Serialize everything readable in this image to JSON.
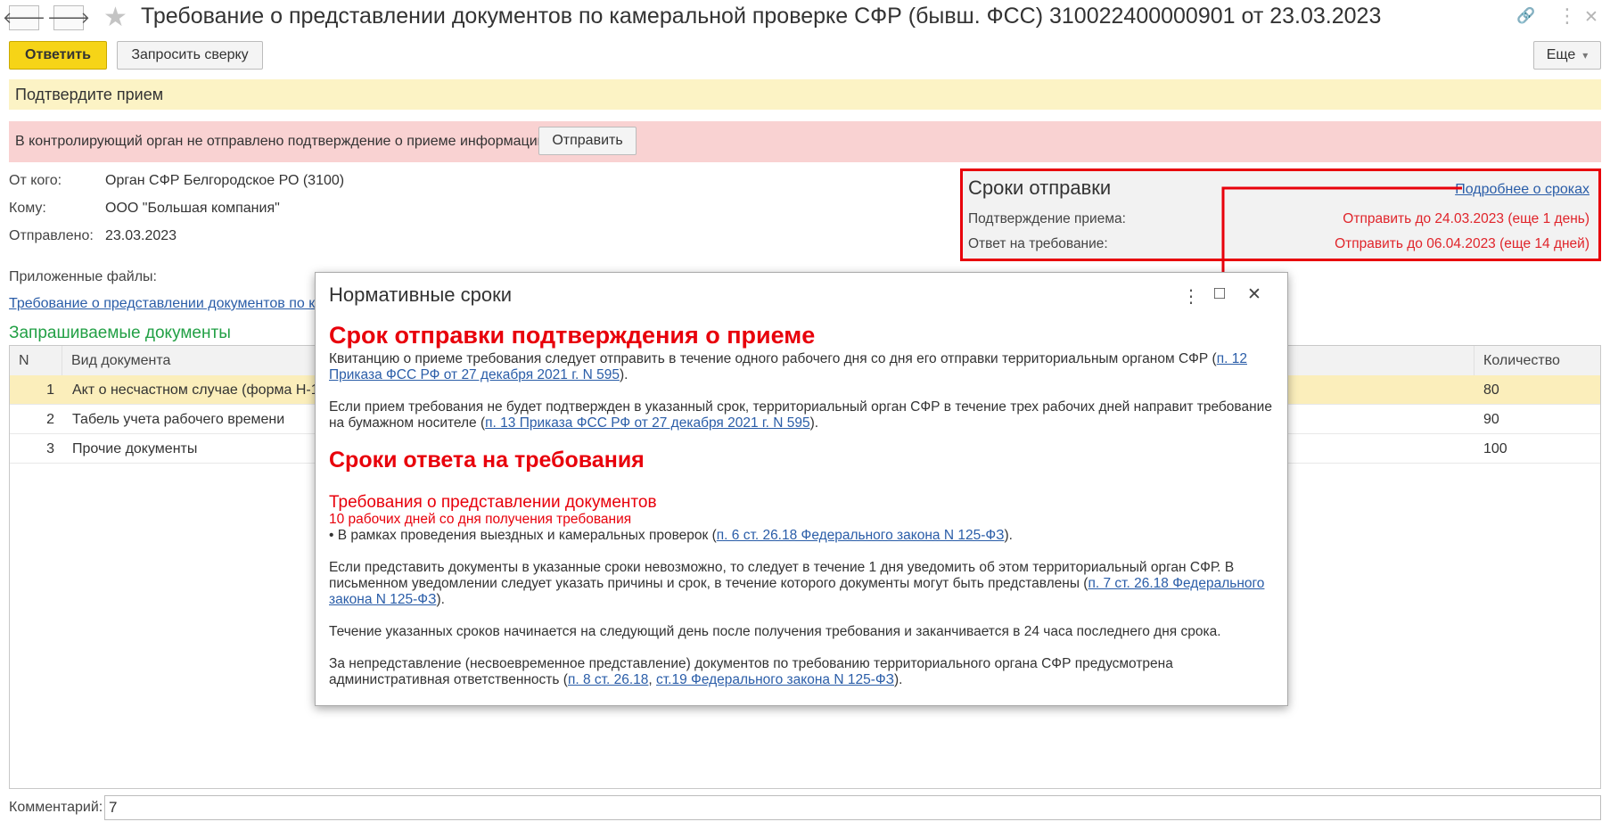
{
  "window": {
    "title": "Требование о представлении документов по камеральной проверке СФР (бывш. ФСС) 310022400000901 от 23.03.2023",
    "back_glyph": "🡐",
    "forward_glyph": "🡒",
    "favorite_glyph": "★",
    "link_glyph": "🔗",
    "menu_glyph": "⋮",
    "close_glyph": "✕"
  },
  "toolbar": {
    "reply_label": "Ответить",
    "reconcile_label": "Запросить сверку",
    "more_label": "Еще",
    "more_glyph": "▾"
  },
  "confirm_bar": {
    "text": "Подтвердите прием"
  },
  "warning_bar": {
    "text": "В контролирующий орган не отправлено подтверждение о приеме информации",
    "send_label": "Отправить"
  },
  "details": {
    "from_label": "От кого:",
    "from_value": "Орган СФР Белгородское РО (3100)",
    "to_label": "Кому:",
    "to_value": "ООО \"Большая компания\"",
    "sent_label": "Отправлено:",
    "sent_value": "23.03.2023",
    "files_label": "Приложенные файлы:",
    "file_link": "Требование о представлении документов по ка"
  },
  "deadlines": {
    "title": "Сроки отправки",
    "details_link": "Подробнее о сроках",
    "rows": [
      {
        "label": "Подтверждение приема:",
        "value": "Отправить до 24.03.2023 (еще 1 день)"
      },
      {
        "label": "Ответ на требование:",
        "value": "Отправить до 06.04.2023 (еще 14 дней)"
      }
    ],
    "accent_color": "#e8000b"
  },
  "documents": {
    "title": "Запрашиваемые документы",
    "columns": {
      "n": "N",
      "type": "Вид документа",
      "qty": "Количество"
    },
    "rows": [
      {
        "n": "1",
        "type": "Акт о несчастном случае (форма Н-1)",
        "qty": "80"
      },
      {
        "n": "2",
        "type": "Табель учета рабочего времени",
        "qty": "90"
      },
      {
        "n": "3",
        "type": "Прочие документы",
        "qty": "100"
      }
    ]
  },
  "comment": {
    "label": "Комментарий:",
    "value": "7"
  },
  "modal": {
    "title": "Нормативные сроки",
    "maximize_glyph": "□",
    "h_confirm": "Срок отправки подтверждения о приеме",
    "p1_text": "Квитанцию о приеме требования следует отправить в течение одного рабочего дня со дня его отправки территориальным органом СФР (",
    "p1_link": "п. 12 Приказа ФСС РФ от 27 декабря 2021 г. N 595",
    "p1_end": ").",
    "p2_text": "Если прием требования не будет подтвержден в указанный срок, территориальный орган СФР в течение трех рабочих дней направит требование на бумажном носителе (",
    "p2_link": "п. 13 Приказа ФСС РФ от 27 декабря 2021 г. N 595",
    "p2_end": ").",
    "h_response": "Сроки ответа на требования",
    "h_docs": "Требования о представлении документов",
    "docs_term": "10 рабочих дней со дня получения требования",
    "bullet_text": "• В рамках проведения выездных и камеральных проверок (",
    "bullet_link": "п. 6 ст. 26.18 Федерального закона N 125-ФЗ",
    "bullet_end": ").",
    "p3_text": "Если представить документы в указанные сроки невозможно, то следует в течение 1 дня уведомить об этом территориальный орган СФР. В письменном уведомлении следует указать причины и срок, в течение которого документы могут быть представлены (",
    "p3_link": "п. 7 ст. 26.18 Федерального закона N 125-ФЗ",
    "p3_end": ").",
    "p4_text": "Течение указанных сроков начинается на следующий день после получения требования и заканчивается в 24 часа последнего дня срока.",
    "p5_text": "За непредставление (несвоевременное представление) документов по требованию территориального органа СФР предусмотрена административная ответственность (",
    "p5_link1": "п. 8 ст. 26.18",
    "p5_sep": ", ",
    "p5_link2": "ст.19 Федерального закона N 125-ФЗ",
    "p5_end": ")."
  }
}
